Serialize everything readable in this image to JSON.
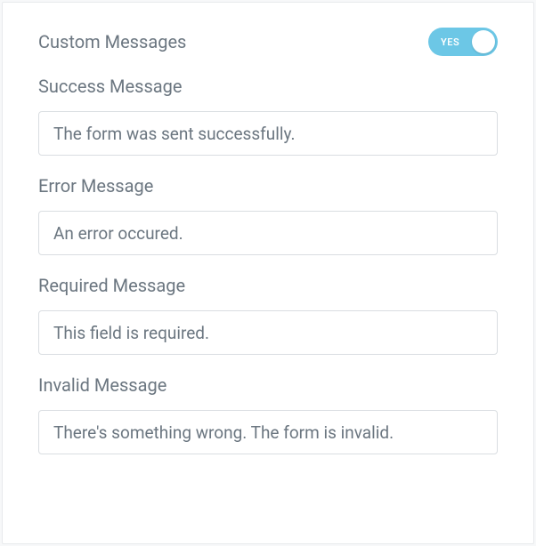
{
  "header": {
    "title": "Custom Messages",
    "toggle_on_label": "YES",
    "toggle_state": true
  },
  "fields": {
    "success": {
      "label": "Success Message",
      "value": "The form was sent successfully."
    },
    "error": {
      "label": "Error Message",
      "value": "An error occured."
    },
    "required": {
      "label": "Required Message",
      "value": "This field is required."
    },
    "invalid": {
      "label": "Invalid Message",
      "value": "There's something wrong. The form is invalid."
    }
  }
}
